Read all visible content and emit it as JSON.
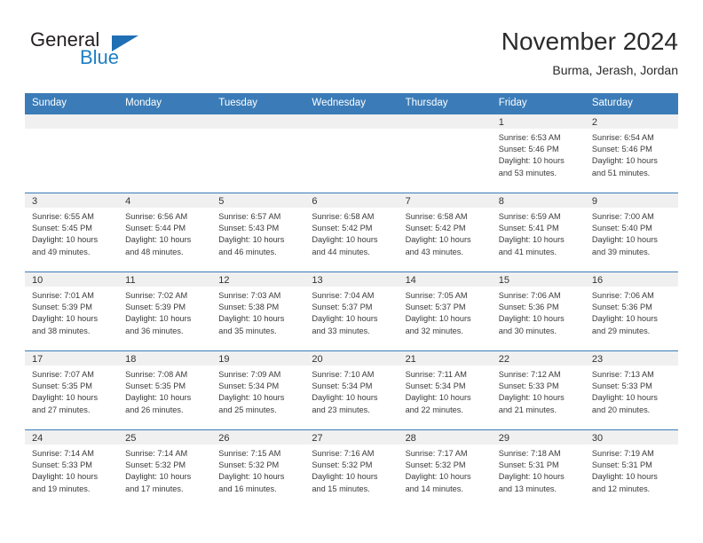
{
  "logo": {
    "word_one": "General",
    "word_two": "Blue",
    "triangle_color": "#1f6fb4"
  },
  "header": {
    "title": "November 2024",
    "subtitle": "Burma, Jerash, Jordan"
  },
  "theme": {
    "header_blue": "#3b7cb8",
    "day_band_gray": "#f0f0f0",
    "text_color": "#3a3a3a"
  },
  "weekdays": [
    "Sunday",
    "Monday",
    "Tuesday",
    "Wednesday",
    "Thursday",
    "Friday",
    "Saturday"
  ],
  "weeks": [
    [
      {
        "day": "",
        "sunrise": "",
        "sunset": "",
        "daylight": ""
      },
      {
        "day": "",
        "sunrise": "",
        "sunset": "",
        "daylight": ""
      },
      {
        "day": "",
        "sunrise": "",
        "sunset": "",
        "daylight": ""
      },
      {
        "day": "",
        "sunrise": "",
        "sunset": "",
        "daylight": ""
      },
      {
        "day": "",
        "sunrise": "",
        "sunset": "",
        "daylight": ""
      },
      {
        "day": "1",
        "sunrise": "Sunrise: 6:53 AM",
        "sunset": "Sunset: 5:46 PM",
        "daylight": "Daylight: 10 hours and 53 minutes."
      },
      {
        "day": "2",
        "sunrise": "Sunrise: 6:54 AM",
        "sunset": "Sunset: 5:46 PM",
        "daylight": "Daylight: 10 hours and 51 minutes."
      }
    ],
    [
      {
        "day": "3",
        "sunrise": "Sunrise: 6:55 AM",
        "sunset": "Sunset: 5:45 PM",
        "daylight": "Daylight: 10 hours and 49 minutes."
      },
      {
        "day": "4",
        "sunrise": "Sunrise: 6:56 AM",
        "sunset": "Sunset: 5:44 PM",
        "daylight": "Daylight: 10 hours and 48 minutes."
      },
      {
        "day": "5",
        "sunrise": "Sunrise: 6:57 AM",
        "sunset": "Sunset: 5:43 PM",
        "daylight": "Daylight: 10 hours and 46 minutes."
      },
      {
        "day": "6",
        "sunrise": "Sunrise: 6:58 AM",
        "sunset": "Sunset: 5:42 PM",
        "daylight": "Daylight: 10 hours and 44 minutes."
      },
      {
        "day": "7",
        "sunrise": "Sunrise: 6:58 AM",
        "sunset": "Sunset: 5:42 PM",
        "daylight": "Daylight: 10 hours and 43 minutes."
      },
      {
        "day": "8",
        "sunrise": "Sunrise: 6:59 AM",
        "sunset": "Sunset: 5:41 PM",
        "daylight": "Daylight: 10 hours and 41 minutes."
      },
      {
        "day": "9",
        "sunrise": "Sunrise: 7:00 AM",
        "sunset": "Sunset: 5:40 PM",
        "daylight": "Daylight: 10 hours and 39 minutes."
      }
    ],
    [
      {
        "day": "10",
        "sunrise": "Sunrise: 7:01 AM",
        "sunset": "Sunset: 5:39 PM",
        "daylight": "Daylight: 10 hours and 38 minutes."
      },
      {
        "day": "11",
        "sunrise": "Sunrise: 7:02 AM",
        "sunset": "Sunset: 5:39 PM",
        "daylight": "Daylight: 10 hours and 36 minutes."
      },
      {
        "day": "12",
        "sunrise": "Sunrise: 7:03 AM",
        "sunset": "Sunset: 5:38 PM",
        "daylight": "Daylight: 10 hours and 35 minutes."
      },
      {
        "day": "13",
        "sunrise": "Sunrise: 7:04 AM",
        "sunset": "Sunset: 5:37 PM",
        "daylight": "Daylight: 10 hours and 33 minutes."
      },
      {
        "day": "14",
        "sunrise": "Sunrise: 7:05 AM",
        "sunset": "Sunset: 5:37 PM",
        "daylight": "Daylight: 10 hours and 32 minutes."
      },
      {
        "day": "15",
        "sunrise": "Sunrise: 7:06 AM",
        "sunset": "Sunset: 5:36 PM",
        "daylight": "Daylight: 10 hours and 30 minutes."
      },
      {
        "day": "16",
        "sunrise": "Sunrise: 7:06 AM",
        "sunset": "Sunset: 5:36 PM",
        "daylight": "Daylight: 10 hours and 29 minutes."
      }
    ],
    [
      {
        "day": "17",
        "sunrise": "Sunrise: 7:07 AM",
        "sunset": "Sunset: 5:35 PM",
        "daylight": "Daylight: 10 hours and 27 minutes."
      },
      {
        "day": "18",
        "sunrise": "Sunrise: 7:08 AM",
        "sunset": "Sunset: 5:35 PM",
        "daylight": "Daylight: 10 hours and 26 minutes."
      },
      {
        "day": "19",
        "sunrise": "Sunrise: 7:09 AM",
        "sunset": "Sunset: 5:34 PM",
        "daylight": "Daylight: 10 hours and 25 minutes."
      },
      {
        "day": "20",
        "sunrise": "Sunrise: 7:10 AM",
        "sunset": "Sunset: 5:34 PM",
        "daylight": "Daylight: 10 hours and 23 minutes."
      },
      {
        "day": "21",
        "sunrise": "Sunrise: 7:11 AM",
        "sunset": "Sunset: 5:34 PM",
        "daylight": "Daylight: 10 hours and 22 minutes."
      },
      {
        "day": "22",
        "sunrise": "Sunrise: 7:12 AM",
        "sunset": "Sunset: 5:33 PM",
        "daylight": "Daylight: 10 hours and 21 minutes."
      },
      {
        "day": "23",
        "sunrise": "Sunrise: 7:13 AM",
        "sunset": "Sunset: 5:33 PM",
        "daylight": "Daylight: 10 hours and 20 minutes."
      }
    ],
    [
      {
        "day": "24",
        "sunrise": "Sunrise: 7:14 AM",
        "sunset": "Sunset: 5:33 PM",
        "daylight": "Daylight: 10 hours and 19 minutes."
      },
      {
        "day": "25",
        "sunrise": "Sunrise: 7:14 AM",
        "sunset": "Sunset: 5:32 PM",
        "daylight": "Daylight: 10 hours and 17 minutes."
      },
      {
        "day": "26",
        "sunrise": "Sunrise: 7:15 AM",
        "sunset": "Sunset: 5:32 PM",
        "daylight": "Daylight: 10 hours and 16 minutes."
      },
      {
        "day": "27",
        "sunrise": "Sunrise: 7:16 AM",
        "sunset": "Sunset: 5:32 PM",
        "daylight": "Daylight: 10 hours and 15 minutes."
      },
      {
        "day": "28",
        "sunrise": "Sunrise: 7:17 AM",
        "sunset": "Sunset: 5:32 PM",
        "daylight": "Daylight: 10 hours and 14 minutes."
      },
      {
        "day": "29",
        "sunrise": "Sunrise: 7:18 AM",
        "sunset": "Sunset: 5:31 PM",
        "daylight": "Daylight: 10 hours and 13 minutes."
      },
      {
        "day": "30",
        "sunrise": "Sunrise: 7:19 AM",
        "sunset": "Sunset: 5:31 PM",
        "daylight": "Daylight: 10 hours and 12 minutes."
      }
    ]
  ]
}
